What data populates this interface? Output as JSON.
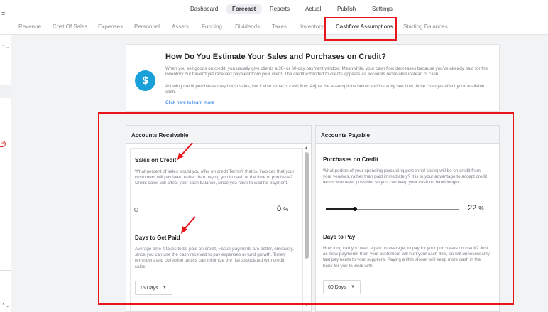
{
  "left_strip": {
    "menu_icon": "≡",
    "updown_icon": "⌃⌄",
    "badge": "ok",
    "updown_icon_bottom": "⌃⌄"
  },
  "topnav": {
    "items": [
      "Dashboard",
      "Forecast",
      "Reports",
      "Actual",
      "Publish",
      "Settings"
    ],
    "active": "Forecast"
  },
  "tabs": {
    "items": [
      "Revenue",
      "Cost Of Sales",
      "Expenses",
      "Personnel",
      "Assets",
      "Funding",
      "Dividends",
      "Taxes",
      "Inventory",
      "Cashflow Assumptions",
      "Starting Balances"
    ],
    "active": "Cashflow Assumptions"
  },
  "info": {
    "icon_symbol": "$",
    "title": "How Do You Estimate Your Sales and Purchases on Credit?",
    "para1": "When you sell goods on credit, you usually give clients a 30- or 60-day payment window. Meanwhile, your cash flow decreases because you've already paid for the inventory but haven't yet received payment from your client. The credit extended to clients appears as accounts receivable instead of cash.",
    "para2": "Allowing credit purchases may boost sales, but it also impacts cash flow. Adjust the assumptions below and instantly see how those changes affect your available cash.",
    "link": "Click here to learn more"
  },
  "ar": {
    "header": "Accounts Receivable",
    "sales_title": "Sales on Credit",
    "sales_desc": "What percent of sales would you offer on credit Terms? that is, invoices that your customers will pay later, rather than paying you in cash at the time of purchase? Credit sales will affect your cash balance, since you have to wait for payment.",
    "sales_value": 0,
    "sales_pct_text": "0",
    "pct_unit": "%",
    "days_title": "Days to Get Paid",
    "days_desc": "Average time it takes to be paid on credit, Faster payments are better, obviously, since you can use the cash received to pay expenses or fund growth. Timely reminders and collection tactics can minimize the risk associated with credit sales.",
    "days_value": "15 Days"
  },
  "ap": {
    "header": "Accounts Payable",
    "purch_title": "Purchases on Credit",
    "purch_desc": "What portion of your spending (excluding personnel costs) will be on credit from your vendors, rather than paid immediately? It is to your advantage to accept credit terms whenever possible, so you can keep your cash on hand longer.",
    "purch_value": 22,
    "purch_pct_text": "22",
    "pct_unit": "%",
    "days_title": "Days to Pay",
    "days_desc": "How long can you wait, again on average, to pay for your purchases on credit? Just as slow payments from your customers will hurt your cash flow, so will unnecessarily fast payments to your suppliers. Paying a little slower will keep more cash in the bank for you to work with.",
    "days_value": "60 Days"
  },
  "colors": {
    "accent": "#1aa0d8",
    "highlight_red": "#e8151b",
    "link": "#1a73e8"
  }
}
